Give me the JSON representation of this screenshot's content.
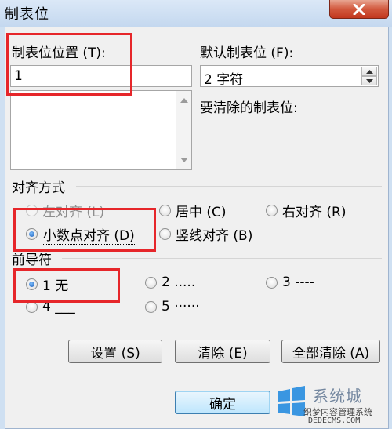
{
  "window": {
    "title": "制表位"
  },
  "tab_position": {
    "label": "制表位位置 (T):",
    "value": "1",
    "list_items": []
  },
  "default_tab": {
    "label": "默认制表位 (F):",
    "value": "2 字符"
  },
  "tabs_to_clear": {
    "label": "要清除的制表位:"
  },
  "alignment": {
    "label": "对齐方式",
    "options": {
      "left": "左对齐 (L)",
      "center": "居中 (C)",
      "right": "右对齐 (R)",
      "decimal": "小数点对齐 (D)",
      "bar": "竖线对齐 (B)"
    },
    "selected": "decimal"
  },
  "leader": {
    "label": "前导符",
    "options": {
      "l1": "1 无",
      "l2": "2 .....",
      "l3": "3 ----",
      "l4": "4 ___",
      "l5": "5 ······"
    },
    "selected": "l1"
  },
  "buttons": {
    "set": "设置 (S)",
    "clear": "清除 (E)",
    "clear_all": "全部清除 (A)",
    "ok": "确定"
  },
  "watermark": {
    "text": "系统城",
    "subtitle": "织梦内容管理系统",
    "url": "DEDECMS.COM"
  },
  "colors": {
    "highlight": "#e6262a",
    "window_frame": "#cfe0f2",
    "close_button": "#c2381f"
  }
}
